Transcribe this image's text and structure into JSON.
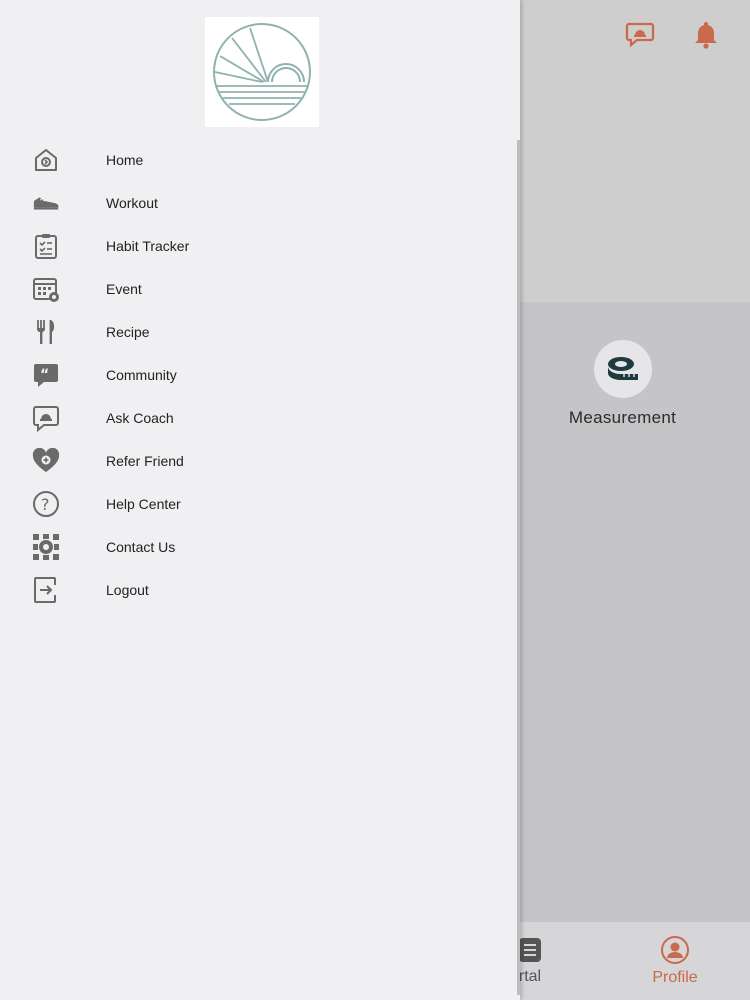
{
  "colors": {
    "accent": "#c96a4a",
    "drawer_bg": "#f0eff1",
    "icon_gray": "#6a6a6a"
  },
  "drawer": {
    "logo_icon": "sun-horizon-logo",
    "menu": [
      {
        "label": "Home",
        "icon": "home-icon"
      },
      {
        "label": "Workout",
        "icon": "sneaker-icon"
      },
      {
        "label": "Habit Tracker",
        "icon": "checklist-icon"
      },
      {
        "label": "Event",
        "icon": "calendar-icon"
      },
      {
        "label": "Recipe",
        "icon": "fork-knife-icon"
      },
      {
        "label": "Community",
        "icon": "quote-bubble-icon"
      },
      {
        "label": "Ask Coach",
        "icon": "coach-chat-icon"
      },
      {
        "label": "Refer Friend",
        "icon": "heart-plus-icon"
      },
      {
        "label": "Help Center",
        "icon": "question-circle-icon"
      },
      {
        "label": "Contact Us",
        "icon": "contact-gear-icon"
      },
      {
        "label": "Logout",
        "icon": "logout-icon"
      }
    ]
  },
  "background": {
    "header_icons": [
      "coach-chat-icon",
      "bell-icon"
    ],
    "tile": {
      "label": "Measurement",
      "icon": "measuring-tape-icon"
    },
    "bottom_nav": [
      {
        "label": "rtal",
        "icon": "portal-icon"
      },
      {
        "label": "Profile",
        "icon": "profile-icon",
        "active": true
      }
    ]
  }
}
